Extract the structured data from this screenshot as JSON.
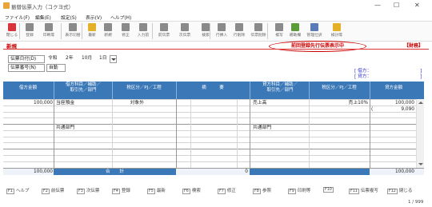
{
  "window": {
    "title": "振替伝票入力（コクヨ式）",
    "minimize": "—",
    "maximize": "☐",
    "close": "✕"
  },
  "menu": [
    "ファイル(F)",
    "編集(E)",
    "設定(S)",
    "表示(V)",
    "ヘルプ(H)"
  ],
  "toolbar": {
    "items": [
      {
        "label": "閉じる",
        "icon": "close-door-icon",
        "color": "#d9343a"
      },
      {
        "label": "登録",
        "icon": "save-icon",
        "color": "#8a8a8a"
      },
      {
        "label": "印刷等",
        "icon": "print-icon",
        "color": "#8a8a8a"
      },
      {
        "label": "表示切替",
        "icon": "view-switch-icon",
        "color": "#8a8a8a"
      },
      {
        "label": "最新",
        "icon": "refresh-icon",
        "color": "#e3b028"
      },
      {
        "label": "新規",
        "icon": "new-doc-icon",
        "color": "#8a8a8a"
      },
      {
        "label": "修正",
        "icon": "edit-icon",
        "color": "#8a8a8a"
      },
      {
        "label": "入力前",
        "icon": "prev-input-icon",
        "color": "#8a8a8a"
      },
      {
        "label": "前伝票",
        "icon": "prev-slip-icon",
        "color": "#8a8a8a"
      },
      {
        "label": "次伝票",
        "icon": "next-slip-icon",
        "color": "#8a8a8a"
      },
      {
        "label": "検索",
        "icon": "search-icon",
        "color": "#8a8a8a"
      },
      {
        "label": "行挿入",
        "icon": "insert-row-icon",
        "color": "#8a8a8a"
      },
      {
        "label": "行削除",
        "icon": "delete-row-icon",
        "color": "#8a8a8a"
      },
      {
        "label": "伝票削除",
        "icon": "delete-slip-icon",
        "color": "#8a8a8a"
      },
      {
        "label": "複写",
        "icon": "copy-icon",
        "color": "#8a8a8a"
      },
      {
        "label": "補助欄",
        "icon": "aux-icon",
        "color": "#5b9c3a"
      },
      {
        "label": "管理仕訳",
        "icon": "manage-icon",
        "color": "#5b7bb8"
      },
      {
        "label": "検討等",
        "icon": "review-icon",
        "color": "#e3b028"
      }
    ]
  },
  "notice": "前回登録先行伝票表示中",
  "mode": "新規",
  "company": "【財務】",
  "form": {
    "date_label": "伝票日付(D)",
    "era": "令和",
    "year": "2年",
    "month": "10月",
    "day": "1日",
    "number_label": "伝票番号(N)",
    "number_value": "自動"
  },
  "balance": {
    "debit_label": "借方：",
    "credit_label": "貸方："
  },
  "table": {
    "headers": {
      "debit_amount": "借方金額",
      "debit_account": "借方科目／補助／",
      "debit_account2": "取引先／部門",
      "debit_tax": "税区分／PJ／工程",
      "memo": "摘　　　要",
      "credit_account": "貸方科目／補助／",
      "credit_account2": "取引先／部門",
      "credit_tax": "税区分／PJ／工程",
      "credit_amount": "貸方金額"
    },
    "row1": {
      "debit_amount": "100,000",
      "debit_account": "当座預金",
      "debit_tax": "対象外",
      "debit_dept": "共通部門",
      "credit_account": "売上高",
      "credit_tax": "売上10%",
      "credit_dept": "共通部門",
      "credit_amount": "100,000",
      "credit_tax_amount": "9,090",
      "credit_tax_paren": "("
    },
    "totals": {
      "debit": "100,000",
      "label": "合　　計",
      "memo": "0",
      "credit": "100,000"
    }
  },
  "function_keys": [
    {
      "key": "F1",
      "label": "ヘルプ"
    },
    {
      "key": "F2",
      "label": "前伝票"
    },
    {
      "key": "F3",
      "label": "次伝票"
    },
    {
      "key": "F4",
      "label": "登録"
    },
    {
      "key": "F5",
      "label": "最新"
    },
    {
      "key": "F6",
      "label": "検索"
    },
    {
      "key": "F7",
      "label": "修正"
    },
    {
      "key": "F8",
      "label": "参照"
    },
    {
      "key": "F9",
      "label": "印刷等"
    },
    {
      "key": "F10",
      "label": ""
    },
    {
      "key": "F11",
      "label": "伝票複写"
    },
    {
      "key": "F12",
      "label": "閉じる"
    }
  ],
  "pager": "1 / 999"
}
